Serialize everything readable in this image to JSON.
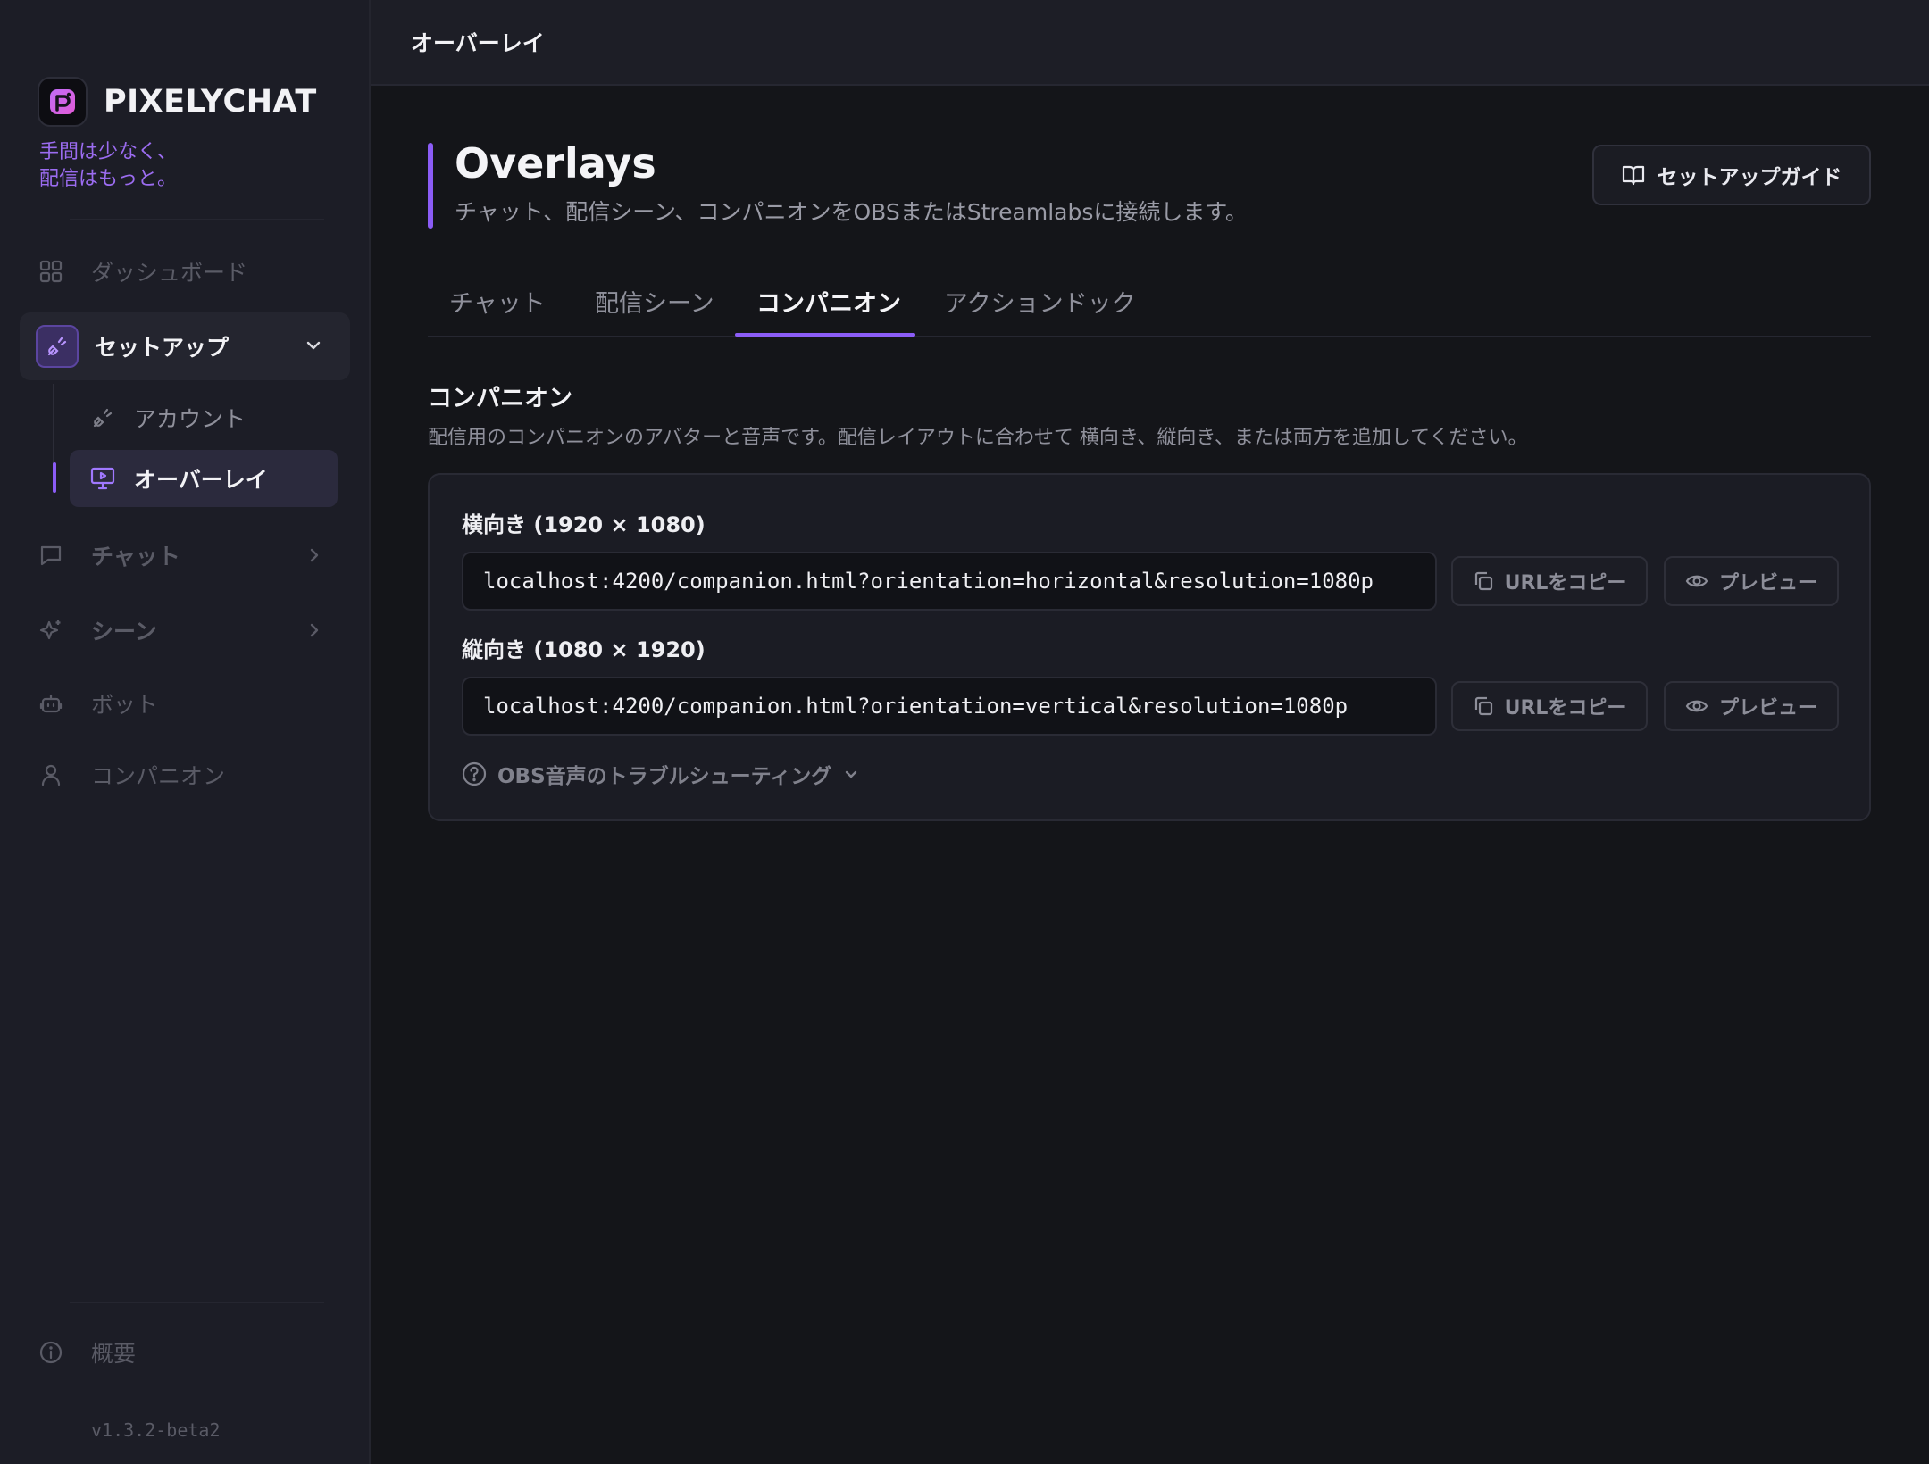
{
  "brand": {
    "name": "PIXELYCHAT",
    "tagline_line1": "手間は少なく、",
    "tagline_line2": "配信はもっと。"
  },
  "sidebar": {
    "dashboard": "ダッシュボード",
    "setup": "セットアップ",
    "account": "アカウント",
    "overlay": "オーバーレイ",
    "chat": "チャット",
    "scene": "シーン",
    "bot": "ボット",
    "companion": "コンパニオン",
    "about": "概要",
    "version": "v1.3.2-beta2"
  },
  "topbar": {
    "title": "オーバーレイ"
  },
  "page": {
    "title": "Overlays",
    "subtitle": "チャット、配信シーン、コンパニオンをOBSまたはStreamlabsに接続します。",
    "guide_button": "セットアップガイド"
  },
  "tabs": [
    {
      "label": "チャット",
      "active": false
    },
    {
      "label": "配信シーン",
      "active": false
    },
    {
      "label": "コンパニオン",
      "active": true
    },
    {
      "label": "アクションドック",
      "active": false
    }
  ],
  "section": {
    "title": "コンパニオン",
    "description": "配信用のコンパニオンのアバターと音声です。配信レイアウトに合わせて 横向き、縦向き、または両方を追加してください。"
  },
  "horizontal": {
    "label": "横向き (1920 × 1080)",
    "url": "localhost:4200/companion.html?orientation=horizontal&resolution=1080p",
    "copy_button": "URLをコピー",
    "preview_button": "プレビュー"
  },
  "vertical": {
    "label": "縦向き (1080 × 1920)",
    "url": "localhost:4200/companion.html?orientation=vertical&resolution=1080p",
    "copy_button": "URLをコピー",
    "preview_button": "プレビュー"
  },
  "troubleshoot": {
    "label": "OBS音声のトラブルシューティング"
  },
  "colors": {
    "accent": "#8b5cf6",
    "background": "#141519",
    "sidebar": "#1c1d26"
  }
}
